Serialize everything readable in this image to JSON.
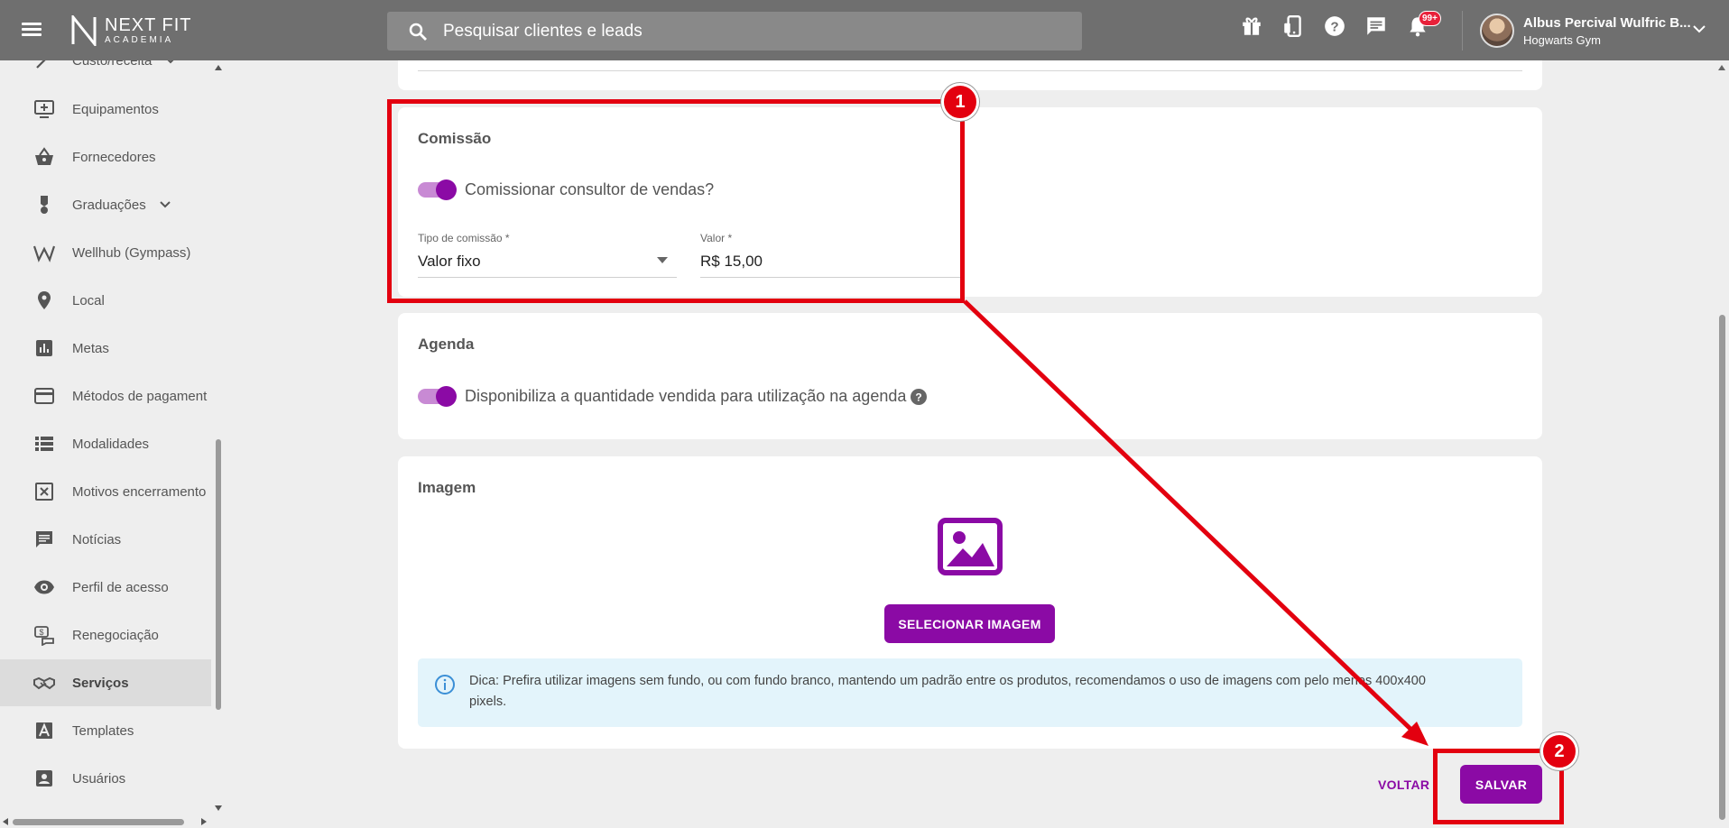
{
  "app": {
    "logo_name": "NEXT FIT",
    "logo_sub": "ACADEMIA",
    "search_placeholder": "Pesquisar clientes e leads",
    "notification_badge": "99+",
    "user_name": "Albus Percival Wulfric B...",
    "user_gym": "Hogwarts Gym"
  },
  "sidebar": {
    "items": [
      {
        "label": "Custo/receita",
        "icon": "trend-icon"
      },
      {
        "label": "Equipamentos",
        "icon": "equipment-icon"
      },
      {
        "label": "Fornecedores",
        "icon": "basket-icon"
      },
      {
        "label": "Graduações",
        "icon": "medal-icon"
      },
      {
        "label": "Wellhub (Gympass)",
        "icon": "wellhub-icon"
      },
      {
        "label": "Local",
        "icon": "location-pin-icon"
      },
      {
        "label": "Metas",
        "icon": "bar-chart-icon"
      },
      {
        "label": "Métodos de pagament",
        "icon": "credit-card-icon"
      },
      {
        "label": "Modalidades",
        "icon": "list-icon"
      },
      {
        "label": "Motivos encerramento",
        "icon": "close-box-icon"
      },
      {
        "label": "Notícias",
        "icon": "message-icon"
      },
      {
        "label": "Perfil de acesso",
        "icon": "eye-icon"
      },
      {
        "label": "Renegociação",
        "icon": "renegotiation-icon"
      },
      {
        "label": "Serviços",
        "icon": "handshake-icon"
      },
      {
        "label": "Templates",
        "icon": "template-icon"
      },
      {
        "label": "Usuários",
        "icon": "user-box-icon"
      }
    ],
    "active": "Serviços"
  },
  "comissao": {
    "title": "Comissão",
    "toggle_label": "Comissionar consultor de vendas?",
    "toggle_on": true,
    "tipo_label": "Tipo de comissão *",
    "tipo_value": "Valor fixo",
    "valor_label": "Valor *",
    "valor_value": "R$ 15,00"
  },
  "agenda": {
    "title": "Agenda",
    "toggle_label": "Disponibiliza a quantidade vendida para utilização na agenda",
    "toggle_on": true
  },
  "imagem": {
    "title": "Imagem",
    "button_label": "SELECIONAR IMAGEM",
    "tip_line1": "Dica: Prefira utilizar imagens sem fundo, ou com fundo branco, mantendo um padrão entre os produtos, recomendamos o uso de imagens com pelo menos 400x400",
    "tip_line2": "pixels."
  },
  "actions": {
    "back_label": "VOLTAR",
    "save_label": "SALVAR"
  },
  "annotations": {
    "badge1": "1",
    "badge2": "2"
  },
  "colors": {
    "primary": "#8b0aa5",
    "annotation": "#e3000f",
    "topbar": "#6f6f6f"
  }
}
